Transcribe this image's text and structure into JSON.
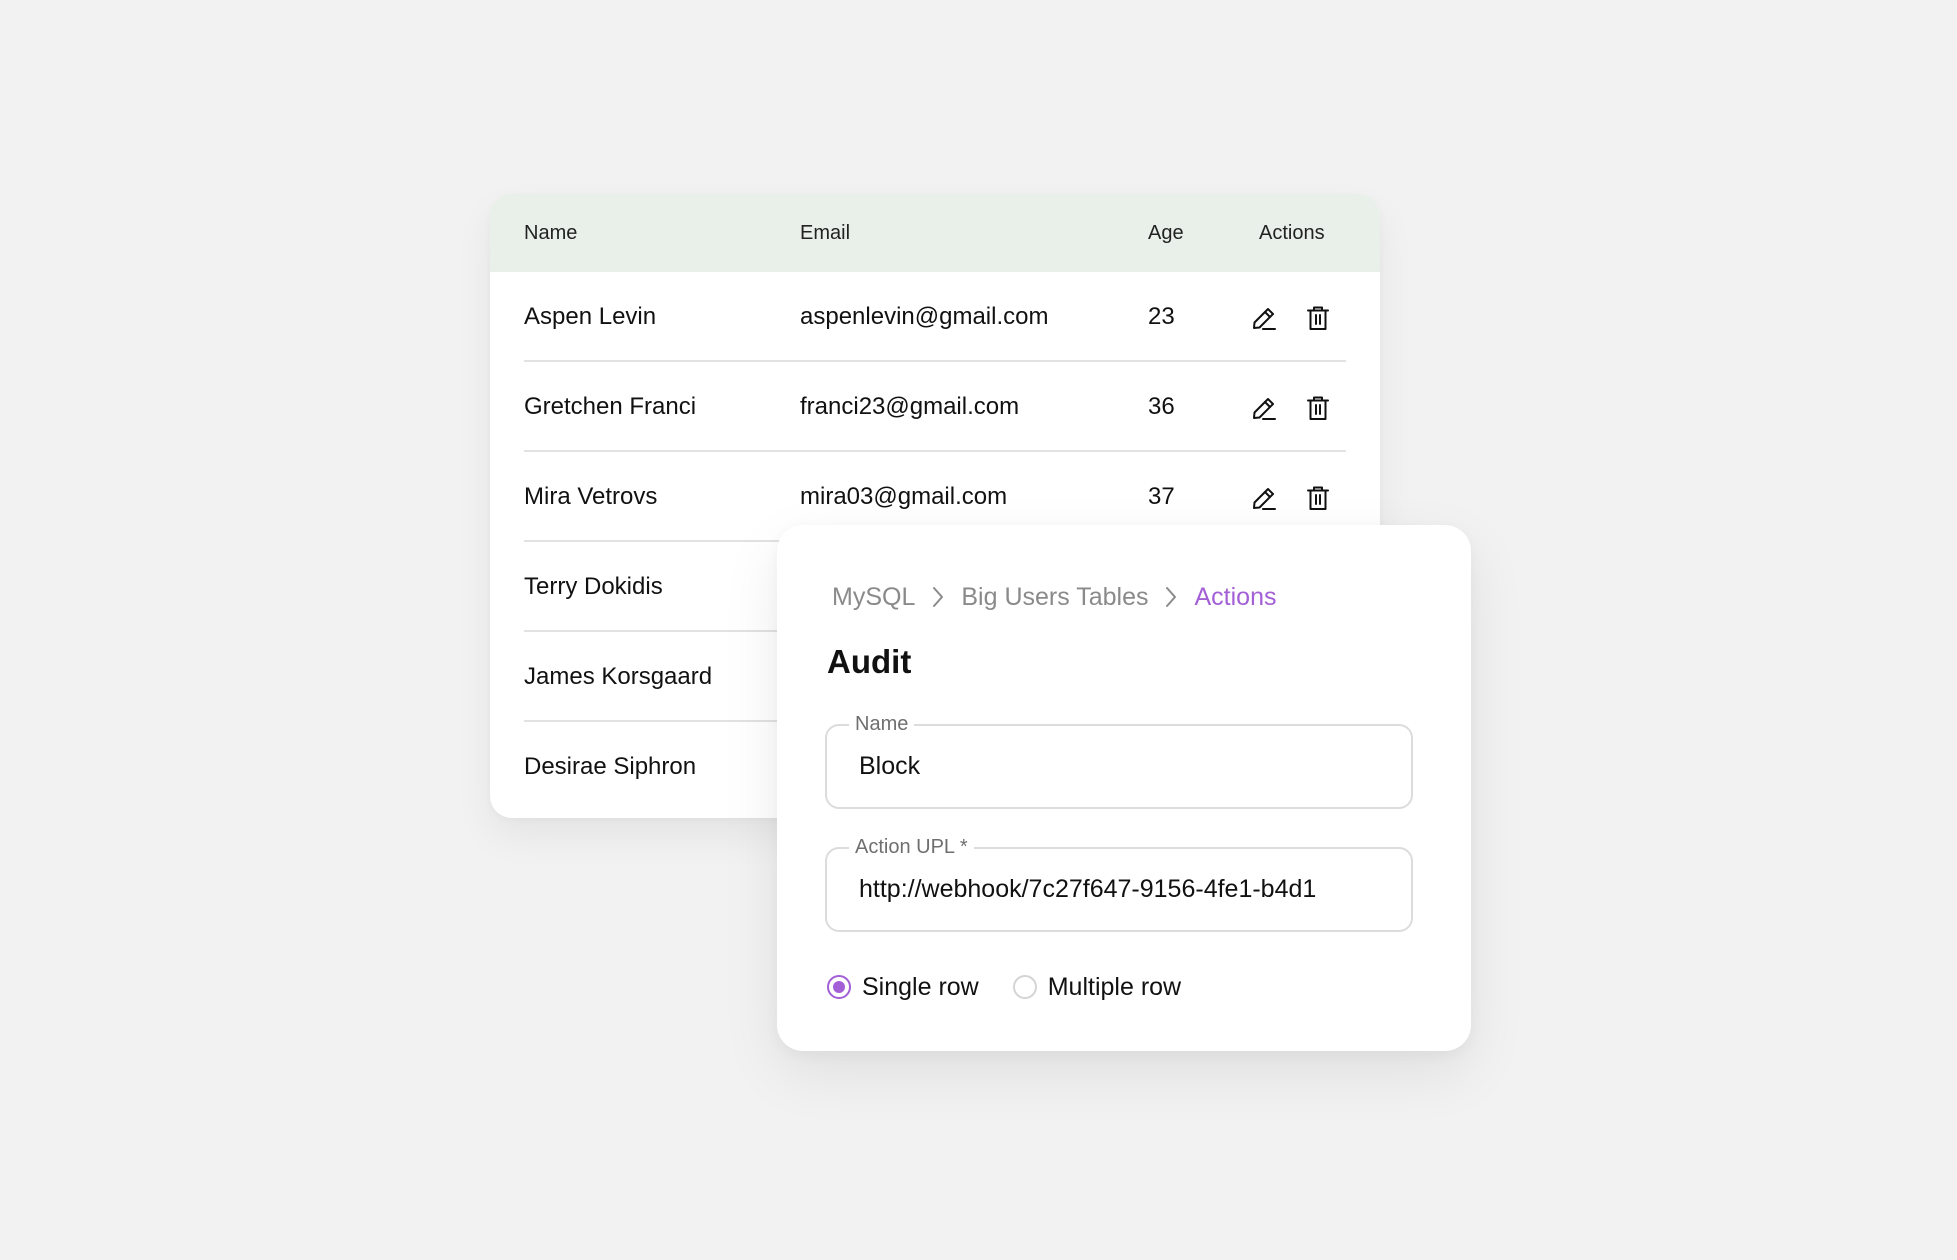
{
  "table": {
    "headers": {
      "name": "Name",
      "email": "Email",
      "age": "Age",
      "actions": "Actions"
    },
    "rows": [
      {
        "name": "Aspen Levin",
        "email": "aspenlevin@gmail.com",
        "age": "23"
      },
      {
        "name": "Gretchen Franci",
        "email": "franci23@gmail.com",
        "age": "36"
      },
      {
        "name": "Mira Vetrovs",
        "email": "mira03@gmail.com",
        "age": "37"
      },
      {
        "name": "Terry Dokidis",
        "email": "",
        "age": ""
      },
      {
        "name": "James Korsgaard",
        "email": "",
        "age": ""
      },
      {
        "name": "Desirae Siphron",
        "email": "",
        "age": ""
      }
    ],
    "row_action_icons": [
      "pencil-icon",
      "trash-icon"
    ]
  },
  "modal": {
    "breadcrumb": [
      "MySQL",
      "Big Users Tables",
      "Actions"
    ],
    "breadcrumb_separator_icon": "chevron-right-icon",
    "title": "Audit",
    "name_field": {
      "label": "Name",
      "value": "Block"
    },
    "url_field": {
      "label": "Action UPL *",
      "value": "http://webhook/7c27f647-9156-4fe1-b4d1"
    },
    "radios": [
      {
        "label": "Single row",
        "checked": true
      },
      {
        "label": "Multiple row",
        "checked": false
      }
    ]
  },
  "colors": {
    "background": "#f2f2f2",
    "table_header_bg": "#e9f0e9",
    "accent": "#a35fd6",
    "muted_text": "#8a8a8a"
  }
}
